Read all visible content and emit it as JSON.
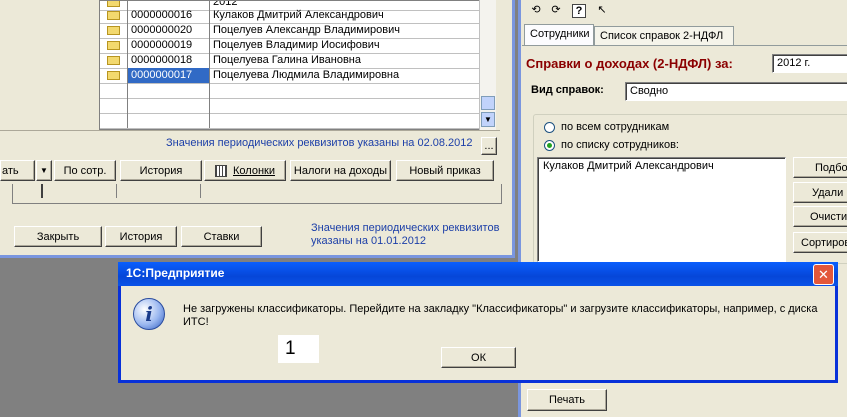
{
  "list_window": {
    "rows": [
      {
        "code": "",
        "name": "2012",
        "selected": false
      },
      {
        "code": "0000000016",
        "name": "Кулаков Дмитрий Александрович",
        "selected": false
      },
      {
        "code": "0000000020",
        "name": "Поцелуев Александр Владимирович",
        "selected": false
      },
      {
        "code": "0000000019",
        "name": "Поцелуев Владимир Иосифович",
        "selected": false
      },
      {
        "code": "0000000018",
        "name": "Поцелуева Галина Ивановна",
        "selected": false
      },
      {
        "code": "0000000017",
        "name": "Поцелуева Людмила Владимировна",
        "selected": true
      }
    ],
    "info_text_1": "Значения периодических реквизитов указаны на 02.08.2012",
    "dots_label": "...",
    "toolbar": {
      "partial_label": "ать",
      "by_employee": "По сотр.",
      "history": "История",
      "columns": "Колонки",
      "income_taxes": "Налоги на доходы",
      "new_order": "Новый приказ"
    },
    "close_button": "Закрыть",
    "history_button": "История",
    "rates_button": "Ставки",
    "info_text_2": "Значения периодических реквизитов указаны на 01.01.2012"
  },
  "ndfl_window": {
    "tabs": [
      "Сотрудники",
      "Список справок 2-НДФЛ"
    ],
    "title": "Справки о доходах (2-НДФЛ) за:",
    "year": "2012 г.",
    "type_label": "Вид справок:",
    "type_value": "Сводно",
    "radio_all": "по всем сотрудникам",
    "radio_list": "по списку сотрудников:",
    "employees": [
      "Кулаков Дмитрий Александрович"
    ],
    "side_buttons": [
      "Подбо",
      "Удали",
      "Очисти",
      "Сортиров"
    ],
    "print_button": "Печать"
  },
  "dialog": {
    "title": "1С:Предприятие",
    "message": "Не загружены классификаторы. Перейдите на закладку \"Классификаторы\" и загрузите классификаторы, например, с диска ИТС!",
    "ok_label": "ОК",
    "number_overlay": "1",
    "close_glyph": "✕",
    "info_glyph": "i"
  }
}
